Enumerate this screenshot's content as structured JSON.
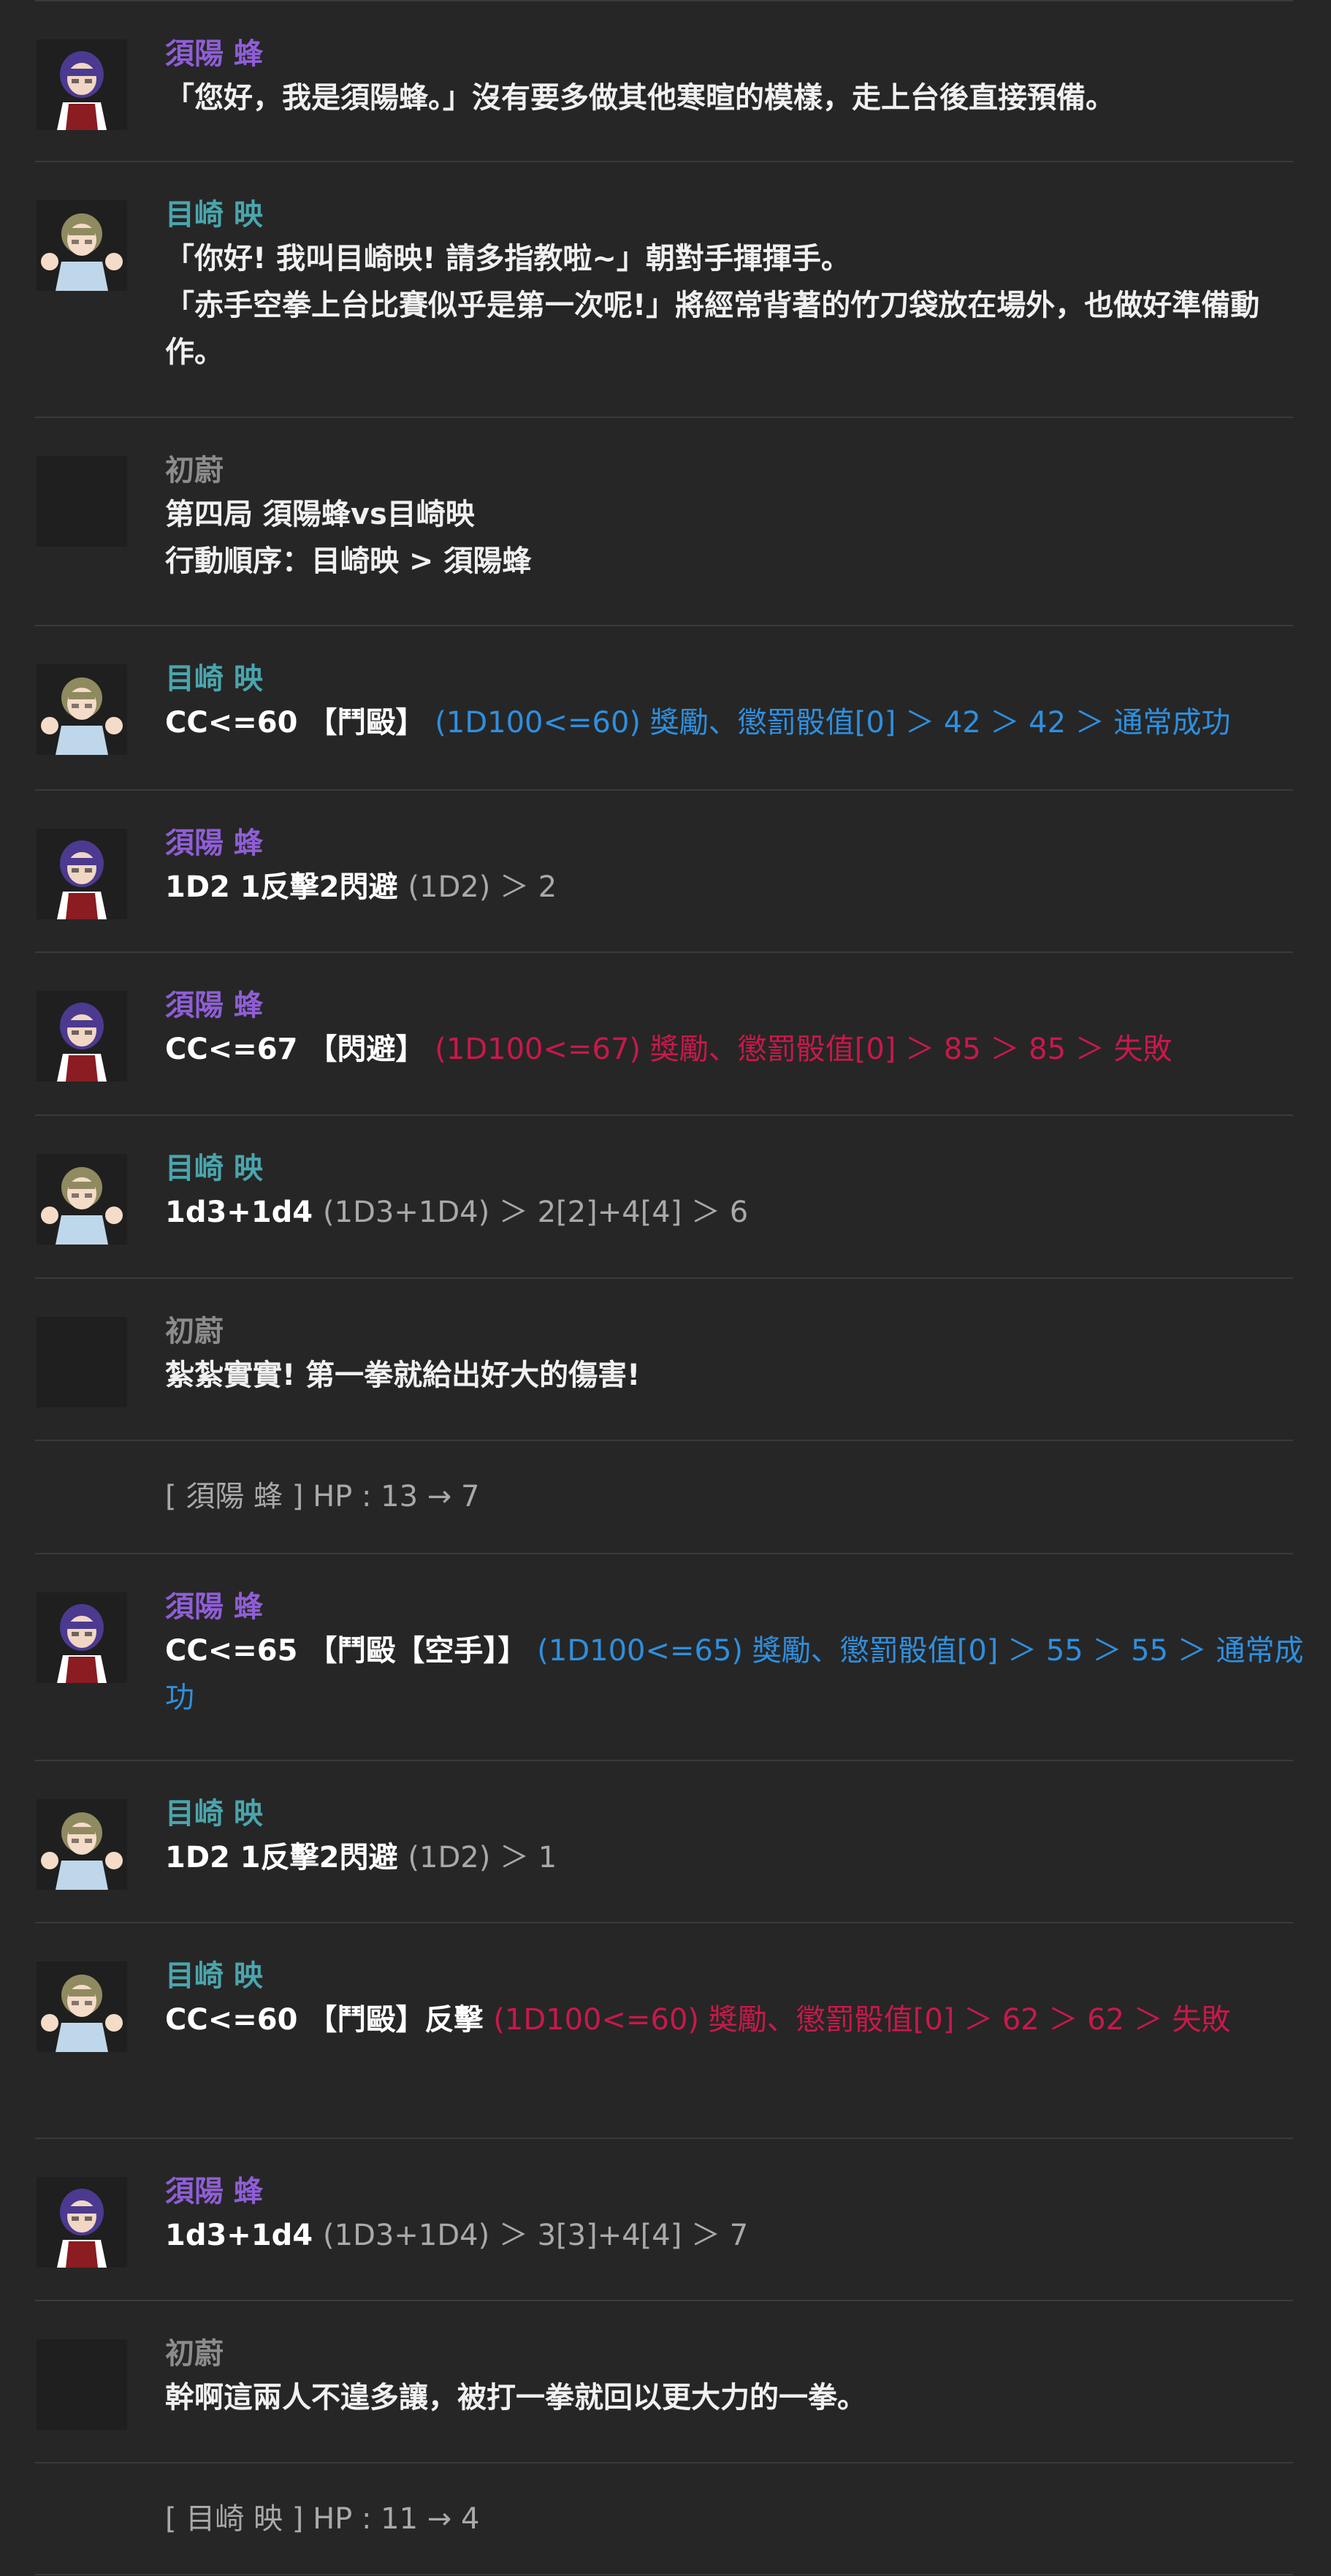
{
  "speakers": {
    "sumi": "須陽 蜂",
    "meza": "目崎 映",
    "gm": "初蔚"
  },
  "messages": [
    {
      "speaker": "須陽 蜂",
      "lines": [
        "「您好，我是須陽蜂。」沒有要多做其他寒暄的模樣，走上台後直接預備。"
      ]
    },
    {
      "speaker": "目崎 映",
      "lines": [
        "「你好! 我叫目崎映! 請多指教啦~」朝對手揮揮手。",
        "「赤手空拳上台比賽似乎是第一次呢!」將經常背著的竹刀袋放在場外，也做好準備動作。"
      ]
    },
    {
      "speaker": "初蔚",
      "lines": [
        "第四局 須陽蜂vs目崎映",
        "行動順序：目崎映 > 須陽蜂"
      ]
    },
    {
      "speaker": "目崎 映",
      "cmd": "CC<=60 【鬥毆】",
      "result": "(1D100<=60) 獎勵、懲罰骰值[0] ＞ 42 ＞ 42 ＞ 通常成功"
    },
    {
      "speaker": "須陽 蜂",
      "cmd": "1D2 1反擊2閃避",
      "result": "(1D2) ＞ 2"
    },
    {
      "speaker": "須陽 蜂",
      "cmd": "CC<=67 【閃避】",
      "result": "(1D100<=67) 獎勵、懲罰骰值[0] ＞ 85 ＞ 85 ＞ 失敗"
    },
    {
      "speaker": "目崎 映",
      "cmd": "1d3+1d4",
      "result": "(1D3+1D4) ＞ 2[2]+4[4] ＞ 6"
    },
    {
      "speaker": "初蔚",
      "lines": [
        "紮紮實實! 第一拳就給出好大的傷害!"
      ]
    },
    {
      "system": "[ 須陽 蜂 ] HP : 13 → 7"
    },
    {
      "speaker": "須陽 蜂",
      "cmd": "CC<=65 【鬥毆【空手】】",
      "result": "(1D100<=65) 獎勵、懲罰骰值[0] ＞ 55 ＞ 55 ＞ 通常成功"
    },
    {
      "speaker": "目崎 映",
      "cmd": "1D2 1反擊2閃避",
      "result": "(1D2) ＞ 1"
    },
    {
      "speaker": "目崎 映",
      "cmd": "CC<=60 【鬥毆】反擊",
      "result": "(1D100<=60) 獎勵、懲罰骰值[0] ＞ 62 ＞ 62 ＞ 失敗"
    },
    {
      "speaker": "須陽 蜂",
      "cmd": "1d3+1d4",
      "result": "(1D3+1D4) ＞ 3[3]+4[4] ＞ 7"
    },
    {
      "speaker": "初蔚",
      "lines": [
        "幹啊這兩人不遑多讓，被打一拳就回以更大力的一拳。"
      ]
    },
    {
      "system": "[ 目崎 映 ] HP : 11 → 4"
    }
  ],
  "colors": {
    "background": "#262626",
    "name_sumi": "#8f5ed6",
    "name_meza": "#4aa5ad",
    "name_gm": "#8c8c8c",
    "success": "#2f8fdf",
    "failure": "#c8194a",
    "neutral_result": "#a9a9a9"
  }
}
